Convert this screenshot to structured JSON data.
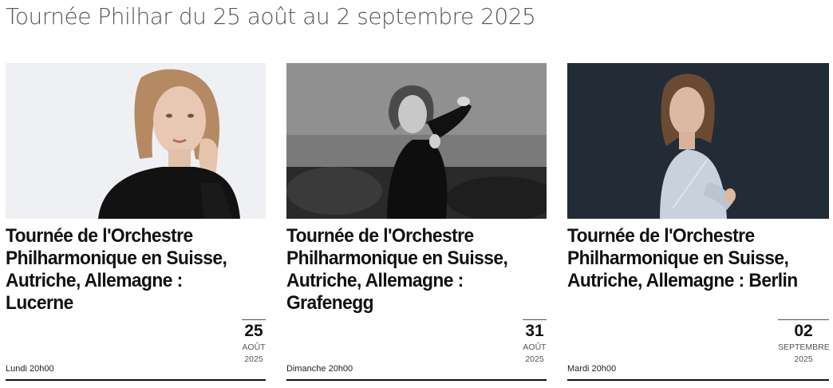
{
  "page": {
    "title": "Tournée Philhar du 25 août au 2 septembre 2025"
  },
  "events": [
    {
      "title": "Tournée de l'Orchestre Philharmonique en Suisse, Autriche, Allemagne : Lucerne",
      "day": "25",
      "month": "AOÛT",
      "year": "2025",
      "time": "Lundi 20h00",
      "image": "portrait-conductor-white-background"
    },
    {
      "title": "Tournée de l'Orchestre Philharmonique en Suisse, Autriche, Allemagne : Grafenegg",
      "day": "31",
      "month": "AOÛT",
      "year": "2025",
      "time": "Dimanche 20h00",
      "image": "conductor-black-and-white-conducting"
    },
    {
      "title": "Tournée de l'Orchestre Philharmonique en Suisse, Autriche, Allemagne : Berlin",
      "day": "02",
      "month": "SEPTEMBRE",
      "year": "2025",
      "time": "Mardi 20h00",
      "image": "conductor-with-baton-dark-background"
    }
  ],
  "colors": {
    "text": "#111111",
    "muted": "#555555",
    "rule": "#111111",
    "background": "#ffffff"
  }
}
